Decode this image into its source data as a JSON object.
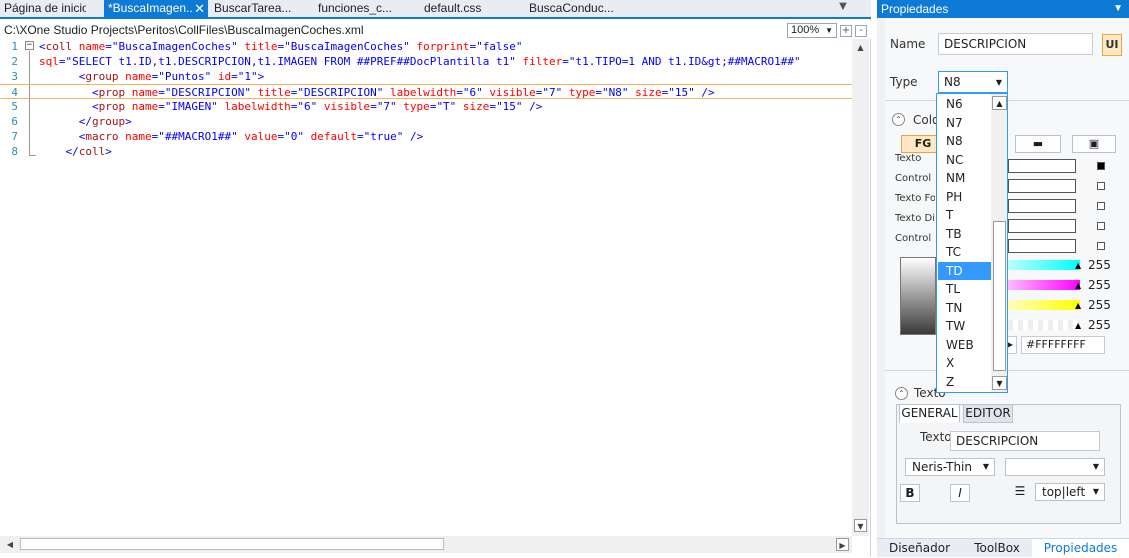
{
  "editor": {
    "tabs": [
      {
        "label": "Página de inicio",
        "active": false
      },
      {
        "label": "*BuscaImagen..",
        "active": true
      },
      {
        "label": "BuscarTarea...",
        "active": false
      },
      {
        "label": "funciones_c...",
        "active": false
      },
      {
        "label": "default.css",
        "active": false
      },
      {
        "label": "BuscaConduc...",
        "active": false
      }
    ],
    "overflow_icon": "chevron-down-icon",
    "file_path": "C:\\XOne Studio Projects\\Peritos\\CollFiles\\BuscaImagenCoches.xml",
    "zoom": "100%",
    "fold_symbol": "−",
    "line_numbers": [
      "1",
      "2",
      "3",
      "4",
      "5",
      "6",
      "7",
      "8"
    ],
    "current_line": 4,
    "code": [
      [
        [
          "brk",
          "<"
        ],
        [
          "tag",
          "coll "
        ],
        [
          "att",
          "name"
        ],
        [
          "brk",
          "="
        ],
        [
          "val",
          "\"BuscaImagenCoches\""
        ],
        [
          "att",
          " title"
        ],
        [
          "brk",
          "="
        ],
        [
          "val",
          "\"BuscaImagenCoches\""
        ],
        [
          "att",
          " forprint"
        ],
        [
          "brk",
          "="
        ],
        [
          "val",
          "\"false\""
        ]
      ],
      [
        [
          "att",
          "sql"
        ],
        [
          "brk",
          "="
        ],
        [
          "val",
          "\"SELECT t1.ID,t1.DESCRIPCION,t1.IMAGEN FROM ##PREF##DocPlantilla t1\""
        ],
        [
          "att",
          " filter"
        ],
        [
          "brk",
          "="
        ],
        [
          "val",
          "\"t1.TIPO=1 AND t1.ID&gt;##MACRO1##\""
        ]
      ],
      [
        [
          "brk",
          "      <"
        ],
        [
          "tag",
          "group "
        ],
        [
          "att",
          "name"
        ],
        [
          "brk",
          "="
        ],
        [
          "val",
          "\"Puntos\""
        ],
        [
          "att",
          " id"
        ],
        [
          "brk",
          "="
        ],
        [
          "val",
          "\"1\""
        ],
        [
          "brk",
          ">"
        ]
      ],
      [
        [
          "brk",
          "        <"
        ],
        [
          "tag",
          "prop "
        ],
        [
          "att",
          "name"
        ],
        [
          "brk",
          "="
        ],
        [
          "val",
          "\"DESCRIPCION\""
        ],
        [
          "att",
          " title"
        ],
        [
          "brk",
          "="
        ],
        [
          "val",
          "\"DESCRIPCION\""
        ],
        [
          "att",
          " labelwidth"
        ],
        [
          "brk",
          "="
        ],
        [
          "val",
          "\"6\""
        ],
        [
          "att",
          " visible"
        ],
        [
          "brk",
          "="
        ],
        [
          "val",
          "\"7\""
        ],
        [
          "att",
          " type"
        ],
        [
          "brk",
          "="
        ],
        [
          "val",
          "\"N8\""
        ],
        [
          "att",
          " size"
        ],
        [
          "brk",
          "="
        ],
        [
          "val",
          "\"15\""
        ],
        [
          "brk",
          " />"
        ]
      ],
      [
        [
          "brk",
          "        <"
        ],
        [
          "tag",
          "prop "
        ],
        [
          "att",
          "name"
        ],
        [
          "brk",
          "="
        ],
        [
          "val",
          "\"IMAGEN\""
        ],
        [
          "att",
          " labelwidth"
        ],
        [
          "brk",
          "="
        ],
        [
          "val",
          "\"6\""
        ],
        [
          "att",
          " visible"
        ],
        [
          "brk",
          "="
        ],
        [
          "val",
          "\"7\""
        ],
        [
          "att",
          " type"
        ],
        [
          "brk",
          "="
        ],
        [
          "val",
          "\"T\""
        ],
        [
          "att",
          " size"
        ],
        [
          "brk",
          "="
        ],
        [
          "val",
          "\"15\""
        ],
        [
          "brk",
          " />"
        ]
      ],
      [
        [
          "brk",
          "      </"
        ],
        [
          "tag",
          "group"
        ],
        [
          "brk",
          ">"
        ]
      ],
      [
        [
          "brk",
          "      <"
        ],
        [
          "tag",
          "macro "
        ],
        [
          "att",
          "name"
        ],
        [
          "brk",
          "="
        ],
        [
          "val",
          "\"##MACRO1##\""
        ],
        [
          "att",
          " value"
        ],
        [
          "brk",
          "="
        ],
        [
          "val",
          "\"0\""
        ],
        [
          "att",
          " default"
        ],
        [
          "brk",
          "="
        ],
        [
          "val",
          "\"true\""
        ],
        [
          "brk",
          " />"
        ]
      ],
      [
        [
          "brk",
          "    </"
        ],
        [
          "tag",
          "coll"
        ],
        [
          "brk",
          ">"
        ]
      ]
    ]
  },
  "panel": {
    "title": "Propiedades",
    "name_label": "Name",
    "name_value": "DESCRIPCION",
    "ui_button": "UI",
    "type_label": "Type",
    "type_value": "N8",
    "type_options": [
      "N6",
      "N7",
      "N8",
      "NC",
      "NM",
      "PH",
      "T",
      "TB",
      "TC",
      "TD",
      "TL",
      "TN",
      "TW",
      "WEB",
      "X",
      "Z"
    ],
    "type_selected": "TD",
    "color_section": "Colo",
    "color_tab_fg": "FG",
    "color_rows": [
      "Texto",
      "Control",
      "Texto Foc",
      "Texto Disa",
      "Control D"
    ],
    "color_checks": [
      true,
      false,
      false,
      false,
      false
    ],
    "slider_values": [
      "255",
      "255",
      "255",
      "255"
    ],
    "hex_value": "#FFFFFFFF",
    "texto_section": "Texto",
    "subtabs": [
      "GENERAL",
      "EDITOR"
    ],
    "texto_label": "Texto",
    "texto_value": "DESCRIPCION",
    "font_value": "Neris-Thin",
    "font_size_value": "",
    "bold_label": "B",
    "italic_label": "I",
    "align_value": "top|left",
    "bottom_tabs": [
      "Diseñador",
      "ToolBox",
      "Propiedades"
    ]
  }
}
